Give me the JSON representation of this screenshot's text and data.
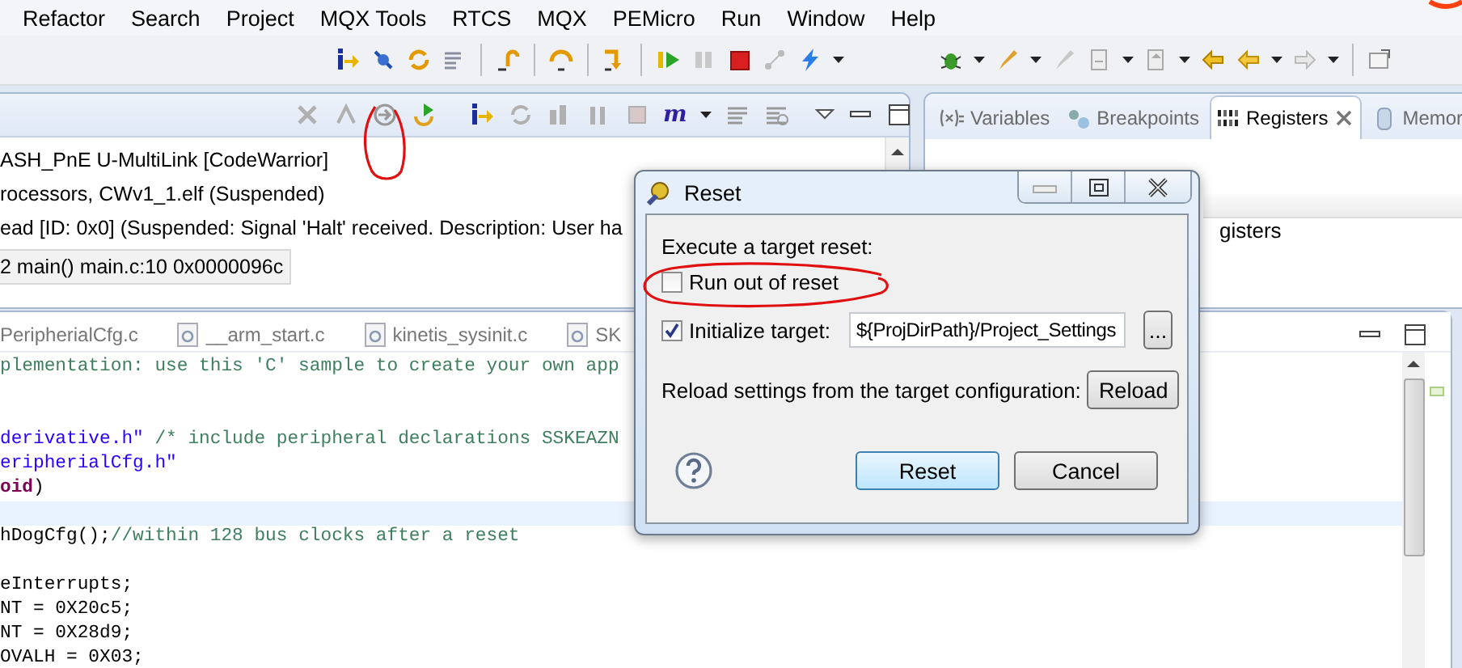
{
  "menu": [
    "Refactor",
    "Search",
    "Project",
    "MQX Tools",
    "RTCS",
    "MQX",
    "PEMicro",
    "Run",
    "Window",
    "Help"
  ],
  "debug_view": {
    "toolbar_label": "m",
    "lines": [
      {
        "text": "ASH_PnE U-MultiLink [CodeWarrior]",
        "selected": false
      },
      {
        "text": "rocessors, CWv1_1.elf (Suspended)",
        "selected": false
      },
      {
        "text": "ead [ID: 0x0] (Suspended: Signal 'Halt' received. Description: User ha",
        "selected": false
      },
      {
        "text": "2 main() main.c:10 0x0000096c",
        "selected": true
      }
    ]
  },
  "views": {
    "tabs": [
      {
        "label": "Variables",
        "kind": "variables",
        "selected": false
      },
      {
        "label": "Breakpoints",
        "kind": "breakpoints",
        "selected": false
      },
      {
        "label": "Registers",
        "kind": "registers",
        "selected": true
      },
      {
        "label": "Memor",
        "kind": "memory",
        "selected": false
      }
    ],
    "content": "gisters"
  },
  "editor": {
    "tabs": [
      {
        "label": "PeripherialCfg.c",
        "kind": "plain"
      },
      {
        "label": "__arm_start.c",
        "kind": "c"
      },
      {
        "label": "kinetis_sysinit.c",
        "kind": "c"
      },
      {
        "label": "SK",
        "kind": "h"
      }
    ],
    "lines": [
      {
        "current": false,
        "parts": [
          {
            "text": "plementation: use this 'C' sample to create your own app",
            "kind": "comment"
          }
        ]
      },
      {
        "current": false
      },
      {
        "current": false
      },
      {
        "current": false,
        "parts": [
          {
            "text": "derivative.h\"",
            "kind": "string"
          },
          {
            "text": " /* include peripheral declarations SSKEAZN",
            "kind": "comment"
          }
        ]
      },
      {
        "current": false,
        "parts": [
          {
            "text": "eripherialCfg.h\"",
            "kind": "string"
          }
        ]
      },
      {
        "current": false,
        "parts": [
          {
            "text": "oid",
            "kind": "keyword"
          },
          {
            "text": ")",
            "kind": "plain"
          }
        ]
      },
      {
        "current": true
      },
      {
        "current": false,
        "parts": [
          {
            "text": "hDogCfg();",
            "kind": "plain"
          },
          {
            "text": "//within 128 bus clocks after a reset",
            "kind": "comment"
          }
        ]
      },
      {
        "current": false
      },
      {
        "current": false,
        "parts": [
          {
            "text": "eInterrupts;",
            "kind": "plain"
          }
        ]
      },
      {
        "current": false,
        "parts": [
          {
            "text": "NT = 0X20c5;",
            "kind": "plain"
          }
        ]
      },
      {
        "current": false,
        "parts": [
          {
            "text": "NT = 0X28d9;",
            "kind": "plain"
          }
        ]
      },
      {
        "current": false,
        "parts": [
          {
            "text": "OVALH = 0X03;",
            "kind": "plain"
          }
        ]
      }
    ]
  },
  "dialog": {
    "title": "Reset",
    "heading": "Execute a target reset:",
    "options": [
      {
        "kind": "checkbox",
        "label": "Run out of reset",
        "checked": false
      },
      {
        "kind": "file",
        "label": "Initialize target:",
        "checked": true,
        "value": "${ProjDirPath}/Project_Settings",
        "browse": "..."
      }
    ],
    "reload_label": "Reload settings from the target configuration:",
    "reload_button": "Reload",
    "buttons": [
      {
        "label": "Reset",
        "default": true
      },
      {
        "label": "Cancel",
        "default": false
      }
    ]
  }
}
